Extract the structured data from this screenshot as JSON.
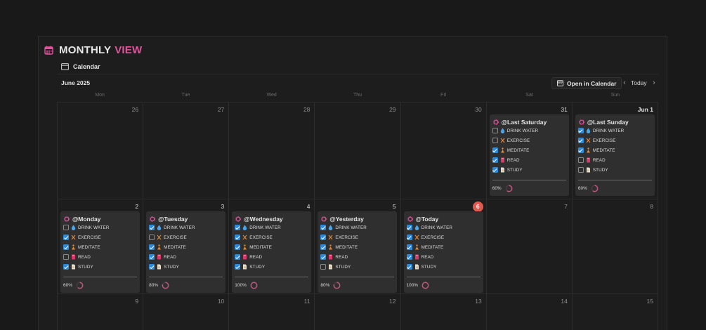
{
  "header": {
    "title_a": "MONTHLY",
    "title_b": "VIEW",
    "view_tab": "Calendar"
  },
  "toolbar": {
    "month": "June 2025",
    "open_in_calendar": "Open in Calendar",
    "today": "Today",
    "prev": "‹",
    "next": "›"
  },
  "weekdays": [
    "Mon",
    "Tue",
    "Wed",
    "Thu",
    "Fri",
    "Sat",
    "Sun"
  ],
  "colors": {
    "accent_pink": "#e0559d",
    "checkbox_blue": "#2b8ad9",
    "today_red": "#e05a4e",
    "ring_pink": "#c0567f"
  },
  "task_icons": [
    "water-drop-icon",
    "dumbbell-icon",
    "meditation-icon",
    "book-icon",
    "document-icon"
  ],
  "weeks": [
    {
      "days": [
        {
          "num": "26"
        },
        {
          "num": "27"
        },
        {
          "num": "28"
        },
        {
          "num": "29"
        },
        {
          "num": "30"
        },
        {
          "num": "31",
          "entry": {
            "title": "@Last Saturday",
            "tasks": [
              {
                "label": "DRINK WATER",
                "done": false
              },
              {
                "label": "EXERCISE",
                "done": false
              },
              {
                "label": "MEDITATE",
                "done": true
              },
              {
                "label": "READ",
                "done": true
              },
              {
                "label": "STUDY",
                "done": true
              }
            ],
            "progress": "60%",
            "progress_value": 0.6
          }
        },
        {
          "num": "Jun 1",
          "bold": true,
          "entry": {
            "title": "@Last Sunday",
            "tasks": [
              {
                "label": "DRINK WATER",
                "done": true
              },
              {
                "label": "EXERCISE",
                "done": true
              },
              {
                "label": "MEDITATE",
                "done": true
              },
              {
                "label": "READ",
                "done": false
              },
              {
                "label": "STUDY",
                "done": false
              }
            ],
            "progress": "60%",
            "progress_value": 0.6
          }
        }
      ]
    },
    {
      "days": [
        {
          "num": "2",
          "entry": {
            "title": "@Monday",
            "tasks": [
              {
                "label": "DRINK WATER",
                "done": false
              },
              {
                "label": "EXERCISE",
                "done": true
              },
              {
                "label": "MEDITATE",
                "done": true
              },
              {
                "label": "READ",
                "done": false
              },
              {
                "label": "STUDY",
                "done": true
              }
            ],
            "progress": "60%",
            "progress_value": 0.6
          }
        },
        {
          "num": "3",
          "entry": {
            "title": "@Tuesday",
            "tasks": [
              {
                "label": "DRINK WATER",
                "done": true
              },
              {
                "label": "EXERCISE",
                "done": false
              },
              {
                "label": "MEDITATE",
                "done": true
              },
              {
                "label": "READ",
                "done": true
              },
              {
                "label": "STUDY",
                "done": true
              }
            ],
            "progress": "80%",
            "progress_value": 0.8
          }
        },
        {
          "num": "4",
          "entry": {
            "title": "@Wednesday",
            "tasks": [
              {
                "label": "DRINK WATER",
                "done": true
              },
              {
                "label": "EXERCISE",
                "done": true
              },
              {
                "label": "MEDITATE",
                "done": true
              },
              {
                "label": "READ",
                "done": true
              },
              {
                "label": "STUDY",
                "done": true
              }
            ],
            "progress": "100%",
            "progress_value": 1.0
          }
        },
        {
          "num": "5",
          "entry": {
            "title": "@Yesterday",
            "tasks": [
              {
                "label": "DRINK WATER",
                "done": true
              },
              {
                "label": "EXERCISE",
                "done": true
              },
              {
                "label": "MEDITATE",
                "done": true
              },
              {
                "label": "READ",
                "done": true
              },
              {
                "label": "STUDY",
                "done": false
              }
            ],
            "progress": "80%",
            "progress_value": 0.8
          }
        },
        {
          "num": "6",
          "today": true,
          "entry": {
            "title": "@Today",
            "tasks": [
              {
                "label": "DRINK WATER",
                "done": true
              },
              {
                "label": "EXERCISE",
                "done": true
              },
              {
                "label": "MEDITATE",
                "done": true
              },
              {
                "label": "READ",
                "done": true
              },
              {
                "label": "STUDY",
                "done": true
              }
            ],
            "progress": "100%",
            "progress_value": 1.0
          }
        },
        {
          "num": "7"
        },
        {
          "num": "8"
        }
      ]
    },
    {
      "days": [
        {
          "num": "9"
        },
        {
          "num": "10"
        },
        {
          "num": "11"
        },
        {
          "num": "12"
        },
        {
          "num": "13"
        },
        {
          "num": "14"
        },
        {
          "num": "15"
        }
      ]
    }
  ]
}
